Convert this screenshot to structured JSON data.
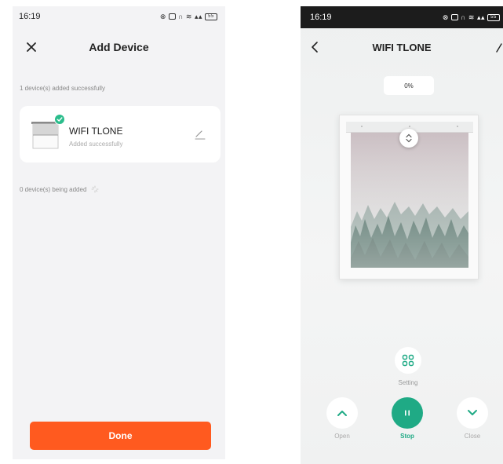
{
  "left_screen": {
    "status_bar": {
      "time": "16:19",
      "battery": "55"
    },
    "header": {
      "title": "Add Device"
    },
    "added_label": "1 device(s) added successfully",
    "device": {
      "name": "WIFI TLONE",
      "status": "Added successfully"
    },
    "adding_label": "0 device(s) being added",
    "done_button": "Done",
    "colors": {
      "accent": "#ff5a1f",
      "success": "#2bbd8c"
    }
  },
  "right_screen": {
    "status_bar": {
      "time": "16:19",
      "battery": "55"
    },
    "header": {
      "title": "WIFI TLONE"
    },
    "position_percent": "0%",
    "controls": {
      "setting": "Setting",
      "open": "Open",
      "stop": "Stop",
      "close": "Close"
    },
    "colors": {
      "accent": "#1faa85"
    }
  }
}
